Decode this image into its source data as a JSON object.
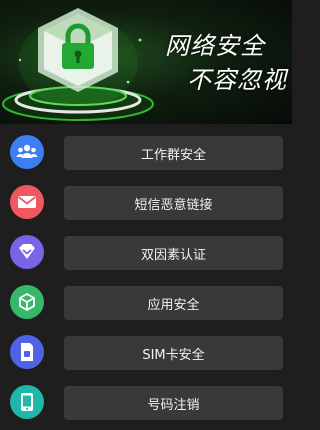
{
  "banner": {
    "slogan_line1": "网络安全",
    "slogan_line2": "不容忽视"
  },
  "menu": {
    "items": [
      {
        "label": "工作群安全",
        "icon": "people-group-icon",
        "color": "#3d7ef2"
      },
      {
        "label": "短信恶意链接",
        "icon": "envelope-icon",
        "color": "#ef5860"
      },
      {
        "label": "双因素认证",
        "icon": "diamond-check-icon",
        "color": "#7b63e8"
      },
      {
        "label": "应用安全",
        "icon": "cube-icon",
        "color": "#36b86a"
      },
      {
        "label": "SIM卡安全",
        "icon": "sim-card-icon",
        "color": "#4f63e6"
      },
      {
        "label": "号码注销",
        "icon": "phone-icon",
        "color": "#1fb8a8"
      }
    ]
  }
}
